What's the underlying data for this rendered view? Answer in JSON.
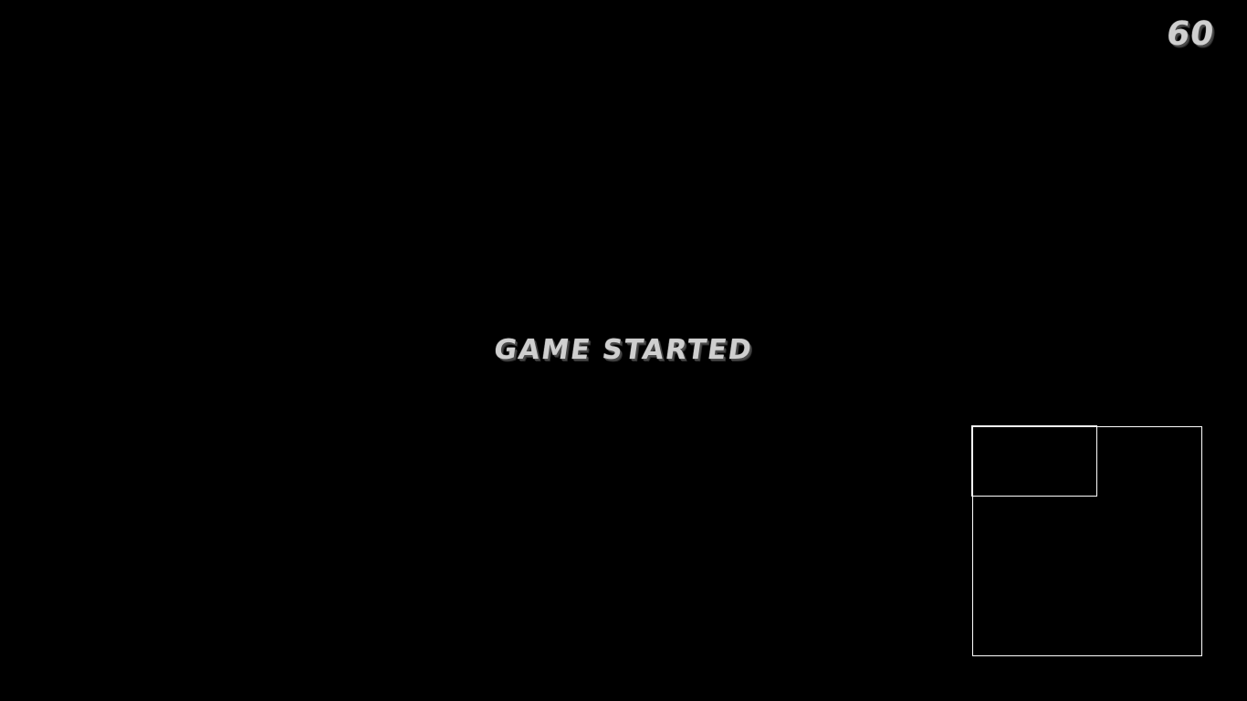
{
  "hud": {
    "fps": "60",
    "status_message": "GAME STARTED"
  },
  "minimap": {
    "border_color": "#ffffff",
    "background_color": "#000000"
  },
  "colors": {
    "background": "#000000",
    "hud_text": "#cfcfcf"
  }
}
